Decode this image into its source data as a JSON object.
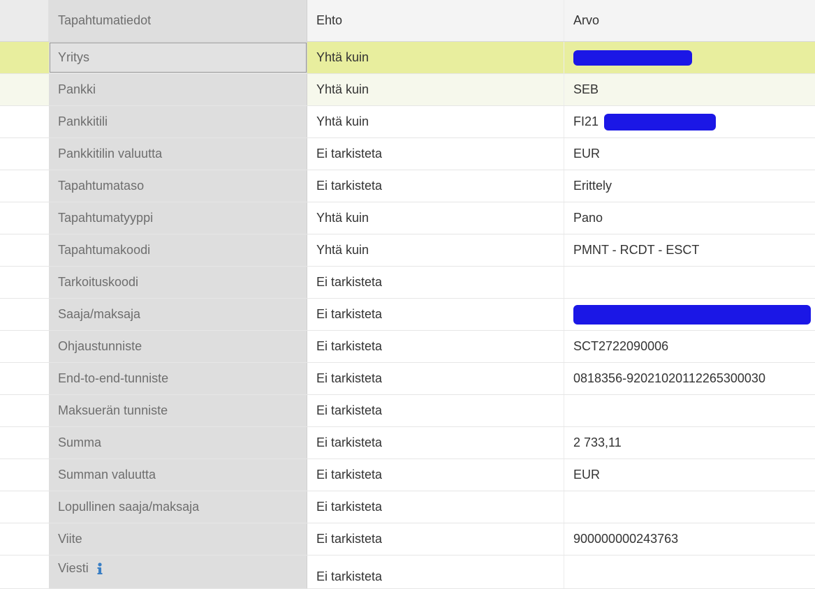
{
  "header": {
    "col1": "Tapahtumatiedot",
    "col2": "Ehto",
    "col3": "Arvo"
  },
  "rows": [
    {
      "field": "Yritys",
      "condition": "Yhtä kuin",
      "value": "",
      "selected": true
    },
    {
      "field": "Pankki",
      "condition": "Yhtä kuin",
      "value": "SEB"
    },
    {
      "field": "Pankkitili",
      "condition": "Yhtä kuin",
      "value": "FI21"
    },
    {
      "field": "Pankkitilin valuutta",
      "condition": "Ei tarkisteta",
      "value": "EUR"
    },
    {
      "field": "Tapahtumataso",
      "condition": "Ei tarkisteta",
      "value": "Erittely"
    },
    {
      "field": "Tapahtumatyyppi",
      "condition": "Yhtä kuin",
      "value": "Pano"
    },
    {
      "field": "Tapahtumakoodi",
      "condition": "Yhtä kuin",
      "value": "PMNT - RCDT - ESCT"
    },
    {
      "field": "Tarkoituskoodi",
      "condition": "Ei tarkisteta",
      "value": ""
    },
    {
      "field": "Saaja/maksaja",
      "condition": "Ei tarkisteta",
      "value": ""
    },
    {
      "field": "Ohjaustunniste",
      "condition": "Ei tarkisteta",
      "value": "SCT2722090006"
    },
    {
      "field": "End-to-end-tunniste",
      "condition": "Ei tarkisteta",
      "value": "0818356-92021020112265300030"
    },
    {
      "field": "Maksuerän tunniste",
      "condition": "Ei tarkisteta",
      "value": ""
    },
    {
      "field": "Summa",
      "condition": "Ei tarkisteta",
      "value": "2 733,11"
    },
    {
      "field": "Summan valuutta",
      "condition": "Ei tarkisteta",
      "value": "EUR"
    },
    {
      "field": "Lopullinen saaja/maksaja",
      "condition": "Ei tarkisteta",
      "value": ""
    },
    {
      "field": "Viite",
      "condition": "Ei tarkisteta",
      "value": "900000000243763"
    },
    {
      "field": "Viesti",
      "condition": "Ei tarkisteta",
      "value": "",
      "icon": "info-icon"
    }
  ],
  "colors": {
    "selected_row": "#e8ee9e",
    "field_column_bg": "#dedede",
    "redaction": "#1b17e6",
    "info_icon": "#3a7fc4"
  }
}
